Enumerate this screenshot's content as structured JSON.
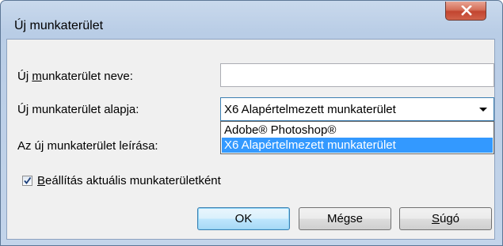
{
  "window": {
    "title": "Új munkaterület"
  },
  "form": {
    "name_label_prefix": "Új ",
    "name_label_mnemonic": "m",
    "name_label_rest": "unkaterület neve:",
    "name_value": "",
    "base_label": "Új munkaterület alapja:",
    "base_selected": "X6 Alapértelmezett munkaterület",
    "base_options": [
      "Adobe® Photoshop®",
      "X6 Alapértelmezett munkaterület"
    ],
    "description_label": "Az új munkaterület leírása:",
    "set_current_checked": true,
    "set_current_mnemonic": "B",
    "set_current_rest": "eállítás aktuális munkaterületként"
  },
  "buttons": {
    "ok": "OK",
    "cancel": "Mégse",
    "help_mnemonic": "S",
    "help_rest": "úgó"
  },
  "colors": {
    "selection": "#3399ff",
    "dialog_bg": "#f0f0f0",
    "close_button": "#c24530"
  },
  "icons": {
    "close": "close-icon",
    "dropdown": "chevron-down-icon",
    "checkmark": "checkmark-icon"
  }
}
